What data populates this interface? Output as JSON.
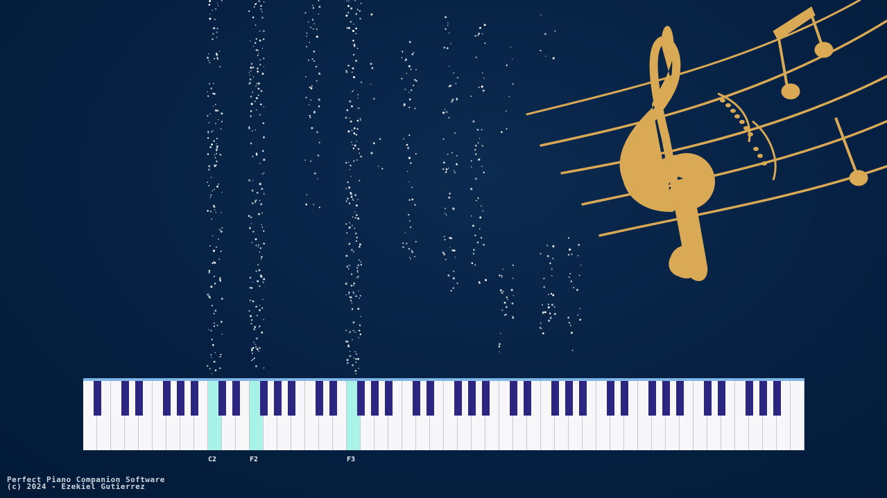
{
  "app": {
    "footer_line1": "Perfect Piano Companion Software",
    "footer_line2": "(c) 2024 - Ezekiel Gutierrez"
  },
  "colors": {
    "background": "#052042",
    "accent_gold": "#d9a955",
    "active_key": "#a9f2e8",
    "black_key": "#2c2680",
    "keyboard_border": "#7fb4e6"
  },
  "keyboard": {
    "white_key_count": 52,
    "active_notes": [
      {
        "note": "C2",
        "label": "C2"
      },
      {
        "note": "F2",
        "label": "F2"
      },
      {
        "note": "F3",
        "label": "F3"
      }
    ]
  },
  "icons": {
    "treble_clef": "treble-clef-icon",
    "music_notes": "music-notes-icon"
  }
}
